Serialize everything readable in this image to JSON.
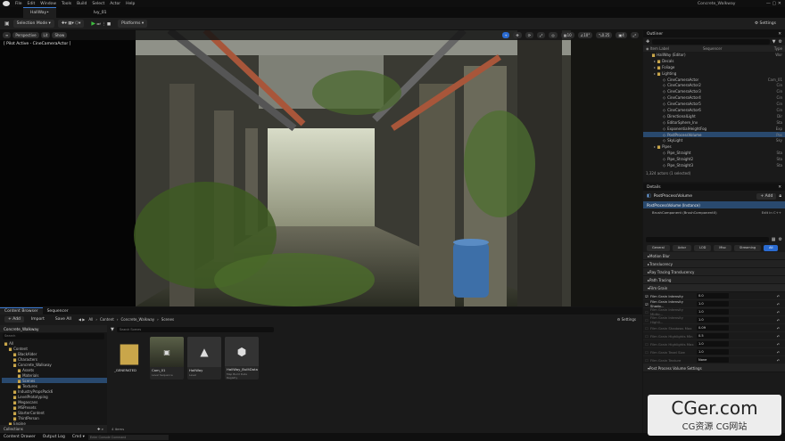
{
  "menu": {
    "items": [
      "File",
      "Edit",
      "Window",
      "Tools",
      "Build",
      "Select",
      "Actor",
      "Help"
    ]
  },
  "title": "Concrete_Walkway",
  "tabs": [
    {
      "label": "HallWay•"
    },
    {
      "label": "Ivy_01"
    }
  ],
  "toolbar": {
    "mode": "Selection Mode",
    "platforms": "Platforms",
    "settings": "Settings"
  },
  "viewport": {
    "perspective": "Perspective",
    "lit": "Lit",
    "show": "Show",
    "pilot": "[ Pilot Active - CineCameraActor ]",
    "fov": "0.25",
    "grid": "10",
    "angle": "10°",
    "cam_speed": "4"
  },
  "outliner": {
    "title": "Outliner",
    "item_label_header": "Item Label",
    "type_header": "Type",
    "sequencer_col": "Sequencer",
    "rows": [
      {
        "label": "HallWay (Editor)",
        "type": "Wor",
        "indent": 0
      },
      {
        "label": "Decals",
        "type": "",
        "indent": 1
      },
      {
        "label": "Foliage",
        "type": "",
        "indent": 1
      },
      {
        "label": "Lighting",
        "type": "",
        "indent": 1
      },
      {
        "label": "CineCameraActor",
        "type": "Cam_01",
        "indent": 2
      },
      {
        "label": "CineCameraActor2",
        "type": "Cin",
        "indent": 2
      },
      {
        "label": "CineCameraActor3",
        "type": "Cin",
        "indent": 2
      },
      {
        "label": "CineCameraActor4",
        "type": "Cin",
        "indent": 2
      },
      {
        "label": "CineCameraActor5",
        "type": "Cin",
        "indent": 2
      },
      {
        "label": "CineCameraActor6",
        "type": "Cin",
        "indent": 2
      },
      {
        "label": "DirectionalLight",
        "type": "Dir",
        "indent": 2
      },
      {
        "label": "EditorSphere_Inv",
        "type": "Sta",
        "indent": 2
      },
      {
        "label": "ExponentialHeightFog",
        "type": "Exp",
        "indent": 2
      },
      {
        "label": "PostProcessVolume",
        "type": "Pos",
        "indent": 2
      },
      {
        "label": "SkyLight",
        "type": "Sky",
        "indent": 2
      },
      {
        "label": "Pipes",
        "type": "",
        "indent": 1
      },
      {
        "label": "Pipe_Straight",
        "type": "Sta",
        "indent": 2
      },
      {
        "label": "Pipe_Straight2",
        "type": "Sta",
        "indent": 2
      },
      {
        "label": "Pipe_Straight3",
        "type": "Sta",
        "indent": 2
      }
    ],
    "selected_index": 13,
    "count": "1,324 actors (1 selected)"
  },
  "details": {
    "title": "Details",
    "actor": "PostProcessVolume",
    "add": "+ Add",
    "instance": "PostProcessVolume (Instance)",
    "component": "BrushComponent (BrushComponent0)",
    "edit_link": "Edit in C++",
    "filters": [
      "General",
      "Actor",
      "LOD",
      "Misc",
      "Streaming",
      "All"
    ],
    "active_filter": 5,
    "categories_top": [
      "Motion Blur",
      "Translucency",
      "Ray Tracing Translucency",
      "Path Tracing"
    ],
    "film_grain": "Film Grain",
    "props": [
      {
        "label": "Film Grain Intensity",
        "value": "0.0",
        "enabled": true
      },
      {
        "label": "Film Grain Intensity Shado...",
        "value": "1.0",
        "enabled": true
      },
      {
        "label": "Film Grain Intensity Midto...",
        "value": "1.0",
        "enabled": false
      },
      {
        "label": "Film Grain Intensity Highli...",
        "value": "1.0",
        "enabled": false
      },
      {
        "label": "Film Grain Shadows Max",
        "value": "0.09",
        "enabled": false
      },
      {
        "label": "Film Grain Highlights Min",
        "value": "0.5",
        "enabled": false
      },
      {
        "label": "Film Grain Highlights Max",
        "value": "1.0",
        "enabled": false
      },
      {
        "label": "Film Grain Texel Size",
        "value": "1.0",
        "enabled": false
      },
      {
        "label": "Film Grain Texture",
        "value": "None",
        "enabled": false
      }
    ],
    "pp_settings": "Post Process Volume Settings"
  },
  "content_browser": {
    "tab": "Content Browser",
    "sequencer_tab": "Sequencer",
    "add": "+ Add",
    "import": "Import",
    "save_all": "Save All",
    "crumbs": [
      "All",
      "Content",
      "Concrete_Walkway",
      "Scenes"
    ],
    "settings": "Settings",
    "search_placeholder": "Search Scenes",
    "root": "Concrete_Walkway",
    "search_tree": "Search",
    "tree": [
      {
        "label": "All",
        "indent": 0
      },
      {
        "label": "Content",
        "indent": 1
      },
      {
        "label": "BlackAlder",
        "indent": 2
      },
      {
        "label": "Characters",
        "indent": 2
      },
      {
        "label": "Concrete_Walkway",
        "indent": 2
      },
      {
        "label": "Assets",
        "indent": 3
      },
      {
        "label": "Materials",
        "indent": 3
      },
      {
        "label": "Scenes",
        "indent": 3
      },
      {
        "label": "Textures",
        "indent": 3
      },
      {
        "label": "IndustryPropsPack6",
        "indent": 2
      },
      {
        "label": "LevelPrototyping",
        "indent": 2
      },
      {
        "label": "Megascans",
        "indent": 2
      },
      {
        "label": "MSPresets",
        "indent": 2
      },
      {
        "label": "StarterContent",
        "indent": 2
      },
      {
        "label": "ThirdPerson",
        "indent": 2
      },
      {
        "label": "Engine",
        "indent": 1
      }
    ],
    "tree_selected": 7,
    "collections": "Collections",
    "assets": [
      {
        "name": "_GENERATED",
        "type": "",
        "kind": "folder"
      },
      {
        "name": "Cam_01",
        "type": "Level Sequence",
        "kind": "seq"
      },
      {
        "name": "HallWay",
        "type": "Level",
        "kind": "level"
      },
      {
        "name": "HallWay_BuiltData",
        "type": "Map Build Data Registry",
        "kind": "data"
      }
    ],
    "items_count": "4 items"
  },
  "status": {
    "content_drawer": "Content Drawer",
    "output_log": "Output Log",
    "cmd": "Cmd",
    "console_placeholder": "Enter Console Command"
  },
  "watermark": {
    "line1": "CGer.com",
    "line2": "CG资源  CG网站"
  },
  "colors": {
    "accent": "#2a6bd1",
    "selection": "#29496e",
    "play": "#3fbf3f"
  }
}
